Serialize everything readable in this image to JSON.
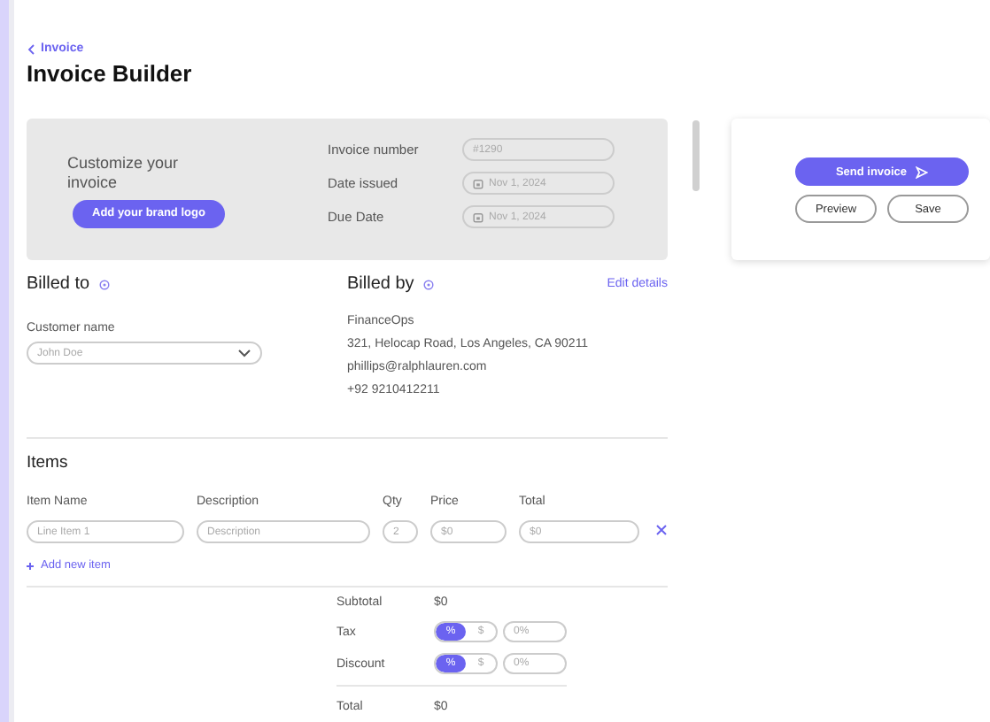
{
  "breadcrumb": "Invoice",
  "title": "Invoice Builder",
  "brand": {
    "text": "Customize your invoice",
    "button": "Add your brand logo"
  },
  "meta": [
    {
      "label": "Invoice number",
      "placeholder": "#1290",
      "kind": "text"
    },
    {
      "label": "Date issued",
      "placeholder": "Nov 1, 2024",
      "kind": "date"
    },
    {
      "label": "Due Date",
      "placeholder": "Nov 1, 2024",
      "kind": "date"
    }
  ],
  "billed_to": {
    "title": "Billed to",
    "field_label": "Customer name",
    "placeholder": "John Doe"
  },
  "billed_by": {
    "title": "Billed by",
    "action": "Edit details",
    "lines": [
      "FinanceOps",
      "321, Helocap Road, Los Angeles, CA 90211",
      "phillips@ralphlauren.com",
      "+92 9210412211"
    ]
  },
  "items": {
    "title": "Items",
    "columns": [
      "Item Name",
      "Description",
      "Qty",
      "Price",
      "Total"
    ],
    "rows": [
      {
        "name": "Line Item 1",
        "description": "Description",
        "qty": "2",
        "price": "$0",
        "total": "$0"
      }
    ],
    "add": "Add new item"
  },
  "summary": [
    {
      "kind": "value",
      "label": "Subtotal",
      "value": "$0"
    },
    {
      "kind": "adjust",
      "label": "Tax",
      "options": [
        {
          "label": "%",
          "selected": true
        },
        {
          "label": "$",
          "selected": false
        }
      ],
      "placeholder": "0%"
    },
    {
      "kind": "adjust",
      "label": "Discount",
      "options": [
        {
          "label": "%",
          "selected": true
        },
        {
          "label": "$",
          "selected": false
        }
      ],
      "placeholder": "0%"
    },
    {
      "kind": "total",
      "label": "Total",
      "value": "$0"
    }
  ],
  "actions": {
    "primary": "Send invoice",
    "secondary": [
      "Preview",
      "Save"
    ]
  }
}
